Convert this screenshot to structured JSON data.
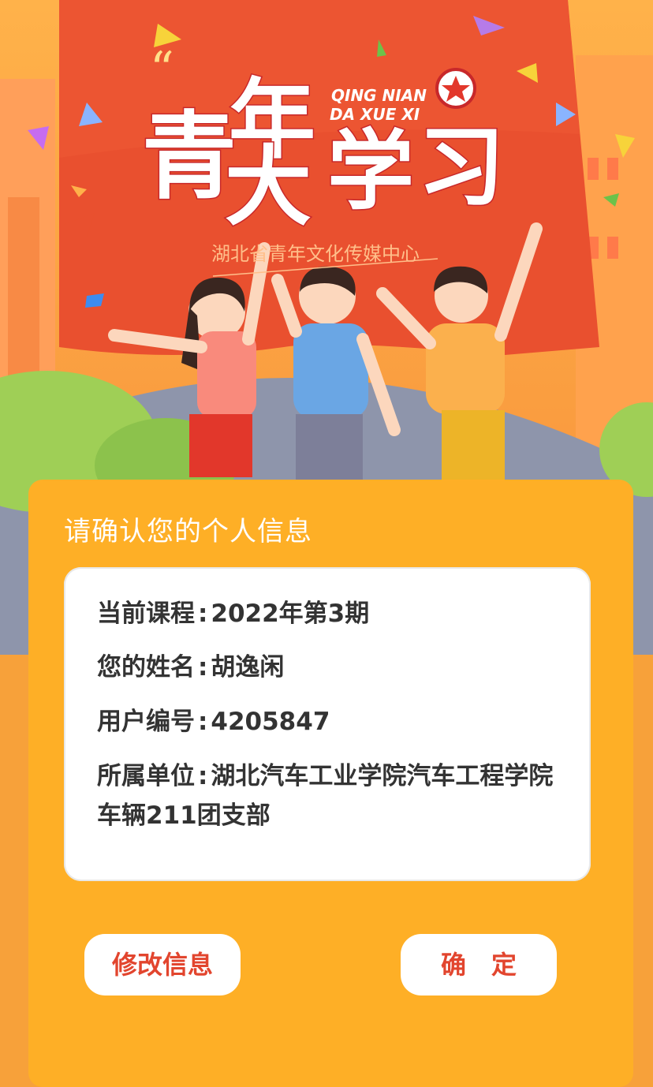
{
  "banner": {
    "title_chars": [
      "青",
      "年",
      "大",
      "学",
      "习"
    ],
    "pinyin_line1": "QING NIAN",
    "pinyin_line2": "DA XUE XI",
    "subtitle": "湖北省青年文化传媒中心",
    "quote_mark": "“"
  },
  "card": {
    "title": "请确认您的个人信息",
    "rows": [
      {
        "label": "当前课程",
        "value": "2022年第3期"
      },
      {
        "label": "您的姓名",
        "value": "胡逸闲"
      },
      {
        "label": "用户编号",
        "value": "4205847"
      },
      {
        "label": "所属单位",
        "value": "湖北汽车工业学院汽车工程学院车辆211团支部"
      }
    ],
    "colon": ":",
    "edit_button": "修改信息",
    "confirm_button": "确　定"
  },
  "colors": {
    "accent": "#e2452e",
    "card": "#feaf26",
    "banner_red": "#e9502f"
  }
}
